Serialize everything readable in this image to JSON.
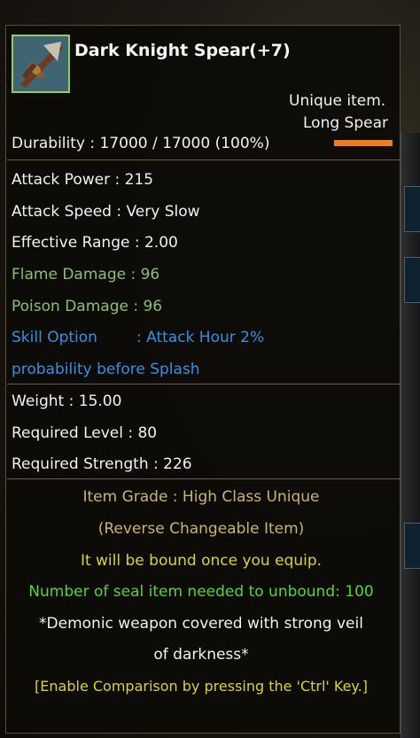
{
  "item": {
    "name": "Dark Knight Spear(+7)",
    "rarity": "Unique item.",
    "type": "Long Spear",
    "durability": "Durability : 17000 / 17000 (100%)",
    "icon": "spear-icon"
  },
  "stats": {
    "attack_power": "Attack Power : 215",
    "attack_speed": "Attack Speed : Very Slow",
    "effective_range": "Effective Range : 2.00",
    "flame_damage": "Flame Damage : 96",
    "poison_damage": "Poison Damage : 96",
    "skill_option_label": "Skill Option",
    "skill_option_value": ": Attack Hour 2%",
    "skill_option_line2": "probability before Splash"
  },
  "requirements": {
    "weight": "Weight : 15.00",
    "level": "Required Level : 80",
    "strength": "Required Strength : 226"
  },
  "notes": {
    "grade": "Item Grade : High Class Unique",
    "changeable": "(Reverse Changeable Item)",
    "bound": "It will be bound once you equip.",
    "seal": "Number of seal item needed to unbound: 100",
    "lore1": "*Demonic weapon covered with strong veil",
    "lore2": "of darkness*",
    "compare": "[Enable Comparison by pressing the 'Ctrl' Key.]"
  },
  "colors": {
    "border": "#9acb55",
    "flame": "#86c170",
    "skill": "#3a8fe0",
    "grade": "#c9b56c",
    "bound": "#d8d23a",
    "seal": "#56d43a",
    "bar": "#ee7d1c"
  }
}
